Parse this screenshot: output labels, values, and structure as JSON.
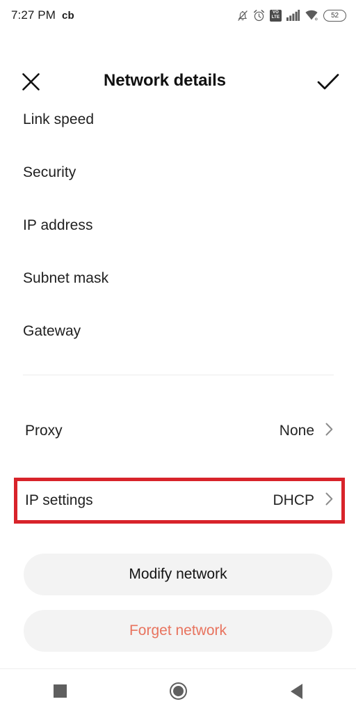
{
  "statusbar": {
    "time": "7:27 PM",
    "carrier": "cb",
    "icons": [
      "bell-muted-icon",
      "alarm-icon",
      "volte-icon",
      "signal-bars-icon",
      "wifi-icon",
      "battery-icon"
    ],
    "volte_top": "VO",
    "volte_bottom": "LTE",
    "battery_level": "52"
  },
  "header": {
    "close_icon": "close-icon",
    "title": "Network details",
    "confirm_icon": "check-icon"
  },
  "info_rows": [
    {
      "label": "Link speed",
      "value": ""
    },
    {
      "label": "Security",
      "value": ""
    },
    {
      "label": "IP address",
      "value": ""
    },
    {
      "label": "Subnet mask",
      "value": ""
    },
    {
      "label": "Gateway",
      "value": ""
    }
  ],
  "settings": {
    "proxy": {
      "label": "Proxy",
      "value": "None",
      "chevron": "chevron-right-icon"
    },
    "ip_settings": {
      "label": "IP settings",
      "value": "DHCP",
      "chevron": "chevron-right-icon"
    }
  },
  "annotation": {
    "target": "ip-settings-row",
    "color": "#d8232a"
  },
  "actions": {
    "modify": "Modify network",
    "forget": "Forget network",
    "forget_color": "#e8735e"
  },
  "navbar": {
    "recents": "recents-square-icon",
    "home": "home-circle-icon",
    "back": "back-triangle-icon"
  }
}
